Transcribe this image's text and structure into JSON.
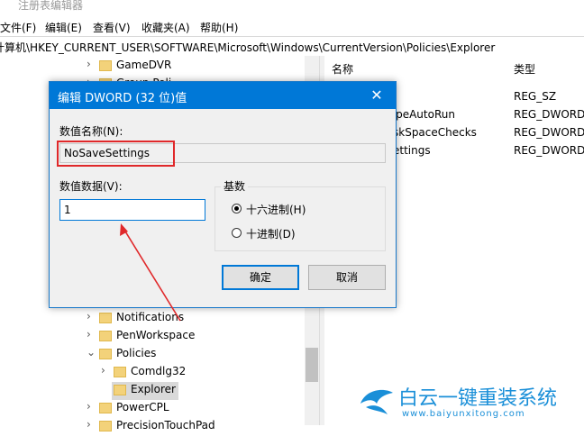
{
  "window": {
    "title": "注册表编辑器"
  },
  "menu": [
    "文件(F)",
    "编辑(E)",
    "查看(V)",
    "收藏夹(A)",
    "帮助(H)"
  ],
  "address": "计算机\\HKEY_CURRENT_USER\\SOFTWARE\\Microsoft\\Windows\\CurrentVersion\\Policies\\Explorer",
  "tree": {
    "items": [
      {
        "label": "GameDVR",
        "chev": "›"
      },
      {
        "label": "Group Poli",
        "chev": "›"
      },
      {
        "label": "Notifications",
        "chev": "›"
      },
      {
        "label": "PenWorkspace",
        "chev": "›"
      },
      {
        "label": "Policies",
        "chev": "⌄"
      },
      {
        "label": "Comdlg32",
        "chev": "›"
      },
      {
        "label": "Explorer",
        "chev": ""
      },
      {
        "label": "PowerCPL",
        "chev": "›"
      },
      {
        "label": "PrecisionTouchPad",
        "chev": "›"
      }
    ]
  },
  "list": {
    "headers": {
      "name": "名称",
      "type": "类型"
    },
    "rows": [
      {
        "name": "",
        "type": "REG_SZ"
      },
      {
        "name": "ypeAutoRun",
        "type": "REG_DWORD"
      },
      {
        "name": "skSpaceChecks",
        "type": "REG_DWORD"
      },
      {
        "name": "ettings",
        "type": "REG_DWORD"
      }
    ]
  },
  "dialog": {
    "title": "编辑 DWORD (32 位)值",
    "name_label": "数值名称(N):",
    "name_value": "NoSaveSettings",
    "data_label": "数值数据(V):",
    "data_value": "1",
    "base_label": "基数",
    "radio_hex": "十六进制(H)",
    "radio_dec": "十进制(D)",
    "ok": "确定",
    "cancel": "取消"
  },
  "watermark": {
    "brand": "白云一键重装系统",
    "url": "www.baiyunxitong.com"
  },
  "colors": {
    "accent": "#0078d7",
    "annotation": "#e0282a"
  }
}
